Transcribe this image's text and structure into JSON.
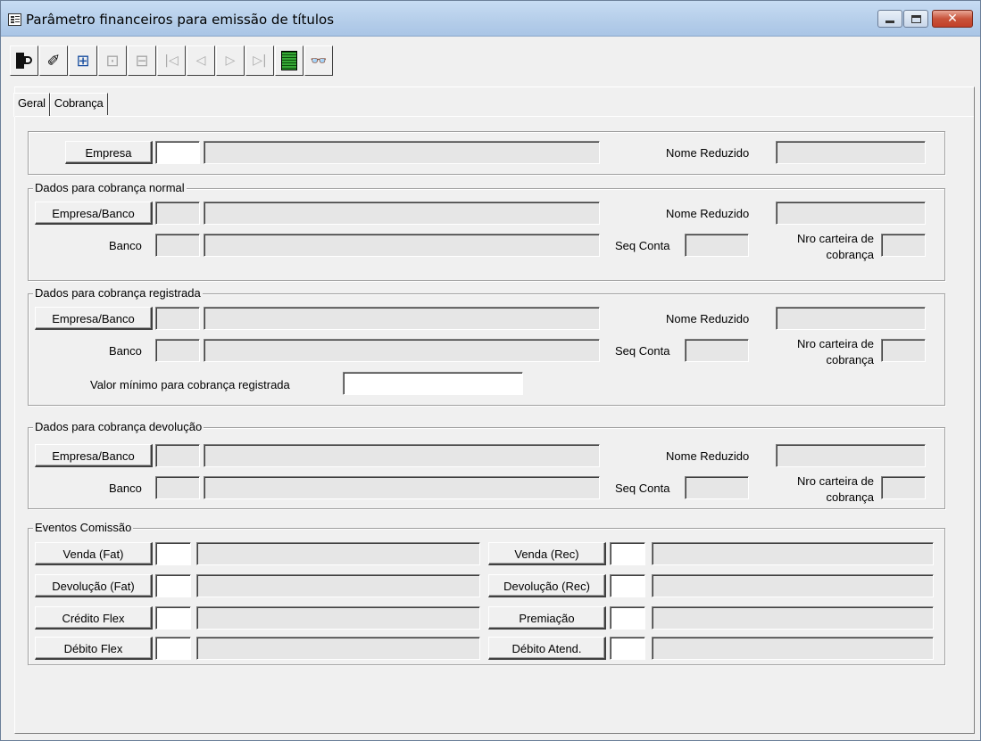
{
  "window": {
    "title": "Parâmetro financeiros para emissão de títulos"
  },
  "toolbar": {
    "buttons": [
      {
        "icon": "exit-icon",
        "enabled": true
      },
      {
        "icon": "eraser-icon",
        "enabled": true
      },
      {
        "icon": "add-record-icon",
        "enabled": true
      },
      {
        "icon": "edit-record-icon",
        "enabled": false
      },
      {
        "icon": "delete-record-icon",
        "enabled": false
      },
      {
        "icon": "first-record-icon",
        "enabled": false
      },
      {
        "icon": "previous-record-icon",
        "enabled": false
      },
      {
        "icon": "next-record-icon",
        "enabled": false
      },
      {
        "icon": "last-record-icon",
        "enabled": false
      },
      {
        "icon": "list-icon",
        "enabled": true
      },
      {
        "icon": "binoculars-icon",
        "enabled": true
      }
    ]
  },
  "tabs": [
    {
      "label": "Geral",
      "active": true
    },
    {
      "label": "Cobrança",
      "active": false
    }
  ],
  "empresa": {
    "button": "Empresa",
    "nome_reduzido_label": "Nome Reduzido",
    "code": "",
    "name": "",
    "short_name": ""
  },
  "normal": {
    "title": "Dados para cobrança normal",
    "empresa_banco_button": "Empresa/Banco",
    "nome_reduzido_label": "Nome Reduzido",
    "banco_label": "Banco",
    "seq_conta_label": "Seq Conta",
    "carteira_label_1": "Nro carteira de",
    "carteira_label_2": "cobrança"
  },
  "registrada": {
    "title": "Dados para cobrança registrada",
    "empresa_banco_button": "Empresa/Banco",
    "nome_reduzido_label": "Nome Reduzido",
    "banco_label": "Banco",
    "seq_conta_label": "Seq Conta",
    "carteira_label_1": "Nro carteira de",
    "carteira_label_2": "cobrança",
    "valor_minimo_label": "Valor mínimo para cobrança registrada",
    "valor_minimo_value": ""
  },
  "devolucao": {
    "title": "Dados para cobrança devolução",
    "empresa_banco_button": "Empresa/Banco",
    "nome_reduzido_label": "Nome Reduzido",
    "banco_label": "Banco",
    "seq_conta_label": "Seq Conta",
    "carteira_label_1": "Nro carteira de",
    "carteira_label_2": "cobrança"
  },
  "eventos": {
    "title": "Eventos Comissão",
    "left": [
      "Venda (Fat)",
      "Devolução (Fat)",
      "Crédito Flex",
      "Débito Flex"
    ],
    "right": [
      "Venda (Rec)",
      "Devolução (Rec)",
      "Premiação",
      "Débito Atend."
    ]
  }
}
